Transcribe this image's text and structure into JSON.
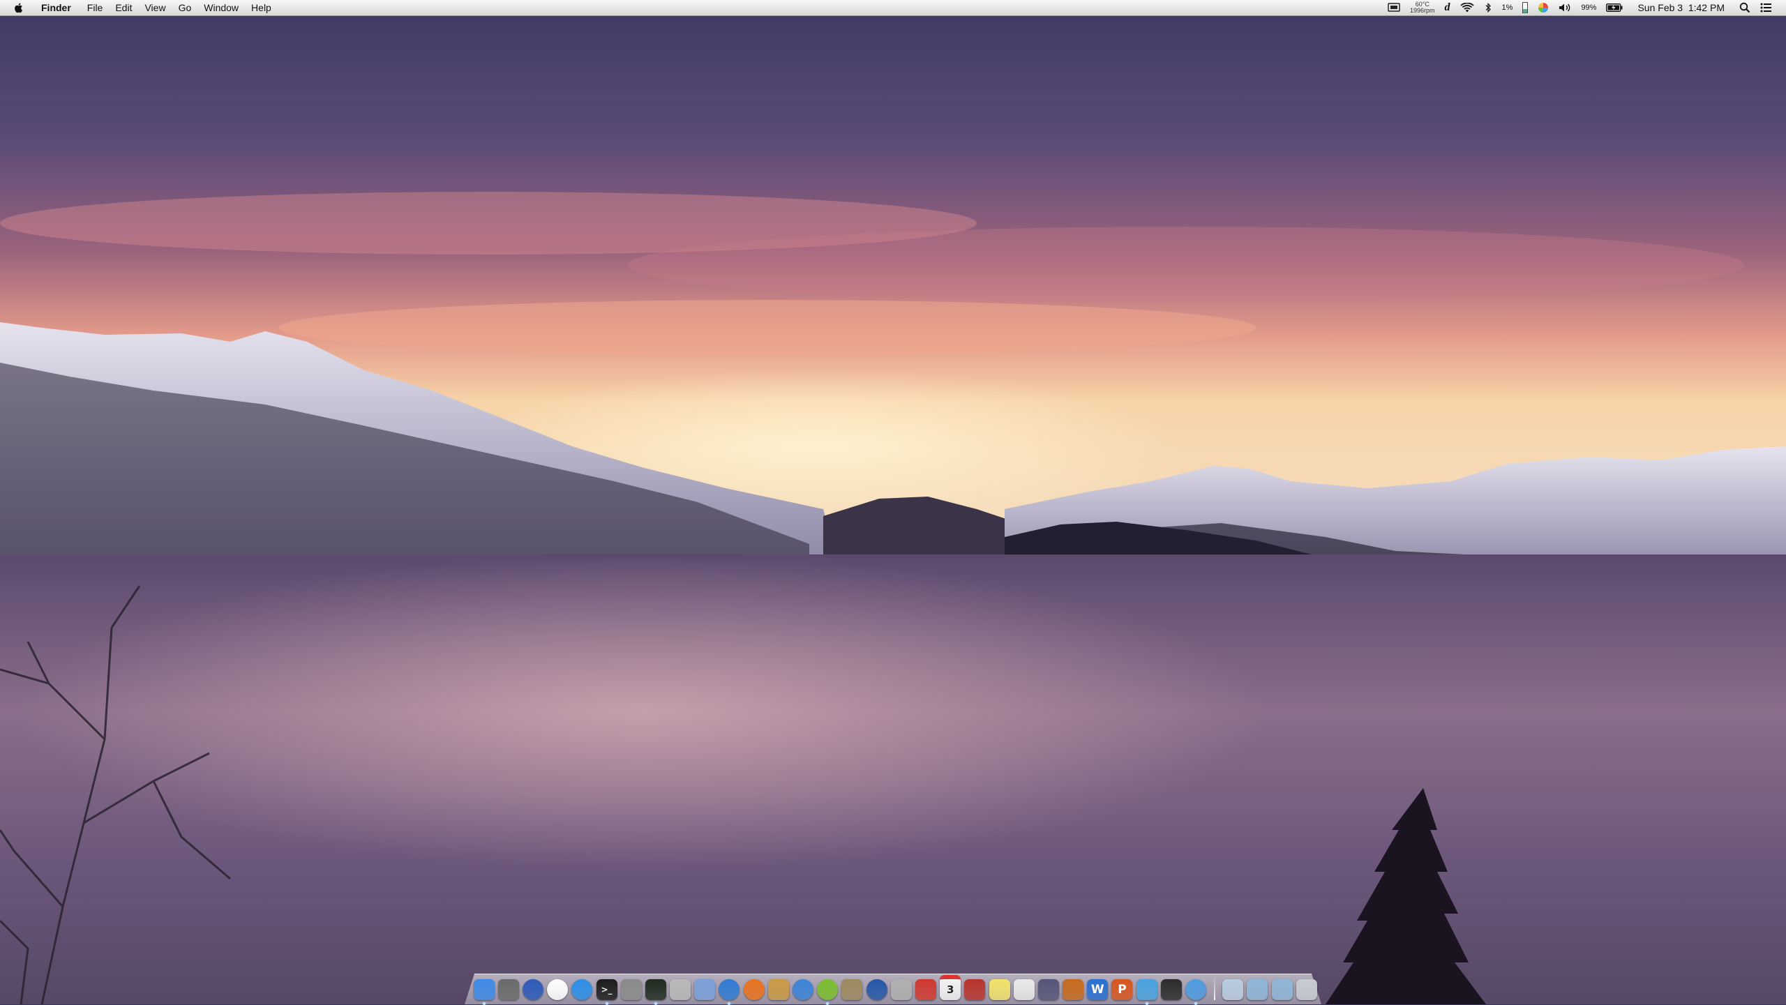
{
  "menubar": {
    "apple_icon": "apple-logo-icon",
    "app_name": "Finder",
    "menus": [
      "File",
      "Edit",
      "View",
      "Go",
      "Window",
      "Help"
    ],
    "status": {
      "temperature": "60°C",
      "fan_speed": "1996rpm",
      "cpu_usage": "1%",
      "battery_percent": "99%",
      "datetime": "Sun Feb 3  1:42 PM"
    }
  },
  "dock": {
    "apps": [
      {
        "name": "finder",
        "color": "#3e8ae6"
      },
      {
        "name": "photo-booth",
        "color": "#6a6a6a"
      },
      {
        "name": "camino",
        "color": "#2c5ab8"
      },
      {
        "name": "wifi-app",
        "color": "#ffffff"
      },
      {
        "name": "app-store",
        "color": "#2d8fe6"
      },
      {
        "name": "terminal",
        "color": "#1c1c1c"
      },
      {
        "name": "utility",
        "color": "#8a8a8a"
      },
      {
        "name": "activity-monitor",
        "color": "#1f2a20"
      },
      {
        "name": "disk-utility",
        "color": "#b9b9b9"
      },
      {
        "name": "preview",
        "color": "#7aa0d8"
      },
      {
        "name": "safari",
        "color": "#2f7bd3"
      },
      {
        "name": "firefox",
        "color": "#e8731d"
      },
      {
        "name": "package-app",
        "color": "#c99a46"
      },
      {
        "name": "app-blue",
        "color": "#3b84d6"
      },
      {
        "name": "spotify",
        "color": "#7bbd2f"
      },
      {
        "name": "iphoto",
        "color": "#9c8a5e"
      },
      {
        "name": "quicktime",
        "color": "#2556a8"
      },
      {
        "name": "automator",
        "color": "#b0b0b0"
      },
      {
        "name": "parallels",
        "color": "#d0382f"
      },
      {
        "name": "calendar",
        "color": "#f2f2f2"
      },
      {
        "name": "address-book",
        "color": "#b8342c"
      },
      {
        "name": "stickies",
        "color": "#f2e36b"
      },
      {
        "name": "textedit",
        "color": "#e9e9e9"
      },
      {
        "name": "script-editor",
        "color": "#555577"
      },
      {
        "name": "keynote",
        "color": "#c66a1c"
      },
      {
        "name": "word",
        "color": "#2a6fd0"
      },
      {
        "name": "powerpoint",
        "color": "#d8561f"
      },
      {
        "name": "twitter",
        "color": "#4aa3df"
      },
      {
        "name": "utility-black",
        "color": "#2b2b2b"
      },
      {
        "name": "messages",
        "color": "#4d9be0"
      }
    ],
    "stacks": [
      {
        "name": "downloads-stack",
        "color": "#b8cde0"
      },
      {
        "name": "applications-folder",
        "color": "#8fb6d8"
      },
      {
        "name": "documents-folder",
        "color": "#8fb6d8"
      },
      {
        "name": "trash",
        "color": "#c7ccd2"
      }
    ],
    "calendar_day": "3",
    "word_letter": "W",
    "powerpoint_letter": "P"
  }
}
